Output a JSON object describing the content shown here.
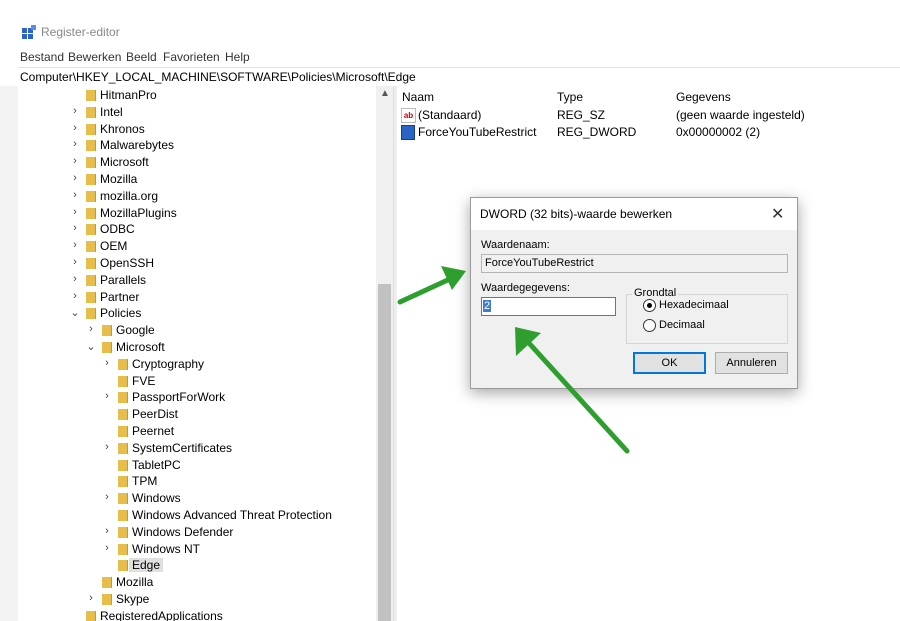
{
  "window": {
    "title": "Register-editor"
  },
  "menu": [
    "Bestand",
    "Bewerken",
    "Beeld",
    "Favorieten",
    "Help"
  ],
  "address": "Computer\\HKEY_LOCAL_MACHINE\\SOFTWARE\\Policies\\Microsoft\\Edge",
  "tree": [
    {
      "label": "HitmanPro",
      "chevron": ""
    },
    {
      "label": "Intel",
      "chevron": "›"
    },
    {
      "label": "Khronos",
      "chevron": "›"
    },
    {
      "label": "Malwarebytes",
      "chevron": "›"
    },
    {
      "label": "Microsoft",
      "chevron": "›"
    },
    {
      "label": "Mozilla",
      "chevron": "›"
    },
    {
      "label": "mozilla.org",
      "chevron": "›"
    },
    {
      "label": "MozillaPlugins",
      "chevron": "›"
    },
    {
      "label": "ODBC",
      "chevron": "›"
    },
    {
      "label": "OEM",
      "chevron": "›"
    },
    {
      "label": "OpenSSH",
      "chevron": "›"
    },
    {
      "label": "Parallels",
      "chevron": "›"
    },
    {
      "label": "Partner",
      "chevron": "›"
    },
    {
      "label": "Policies",
      "chevron": "⌄"
    },
    {
      "label": "Google",
      "chevron": "›"
    },
    {
      "label": "Microsoft",
      "chevron": "⌄"
    },
    {
      "label": "Cryptography",
      "chevron": "›"
    },
    {
      "label": "FVE",
      "chevron": ""
    },
    {
      "label": "PassportForWork",
      "chevron": "›"
    },
    {
      "label": "PeerDist",
      "chevron": ""
    },
    {
      "label": "Peernet",
      "chevron": ""
    },
    {
      "label": "SystemCertificates",
      "chevron": "›"
    },
    {
      "label": "TabletPC",
      "chevron": ""
    },
    {
      "label": "TPM",
      "chevron": ""
    },
    {
      "label": "Windows",
      "chevron": "›"
    },
    {
      "label": "Windows Advanced Threat Protection",
      "chevron": ""
    },
    {
      "label": "Windows Defender",
      "chevron": "›"
    },
    {
      "label": "Windows NT",
      "chevron": "›"
    },
    {
      "label": "Edge",
      "chevron": ""
    },
    {
      "label": "Mozilla",
      "chevron": ""
    },
    {
      "label": "Skype",
      "chevron": "›"
    },
    {
      "label": "RegisteredApplications",
      "chevron": ""
    }
  ],
  "values_pane": {
    "headers": {
      "name": "Naam",
      "type": "Type",
      "data": "Gegevens"
    },
    "rows": [
      {
        "name": "(Standaard)",
        "type": "REG_SZ",
        "data": "(geen waarde ingesteld)",
        "icon": "string-value-icon"
      },
      {
        "name": "ForceYouTubeRestrict",
        "type": "REG_DWORD",
        "data": "0x00000002 (2)",
        "icon": "binary-value-icon"
      }
    ]
  },
  "dialog": {
    "title": "DWORD (32 bits)-waarde bewerken",
    "name_label": "Waardenaam:",
    "name_value": "ForceYouTubeRestrict",
    "data_label": "Waardegegevens:",
    "data_value": "2",
    "base_label": "Grondtal",
    "radio_hex": "Hexadecimaal",
    "radio_dec": "Decimaal",
    "selected_base": "hex",
    "ok": "OK",
    "cancel": "Annuleren",
    "close_glyph": "✕"
  },
  "colors": {
    "annotation_arrow": "#2e9e2e",
    "selection": "#3c7bd6",
    "folder": "#e8bd4a"
  }
}
